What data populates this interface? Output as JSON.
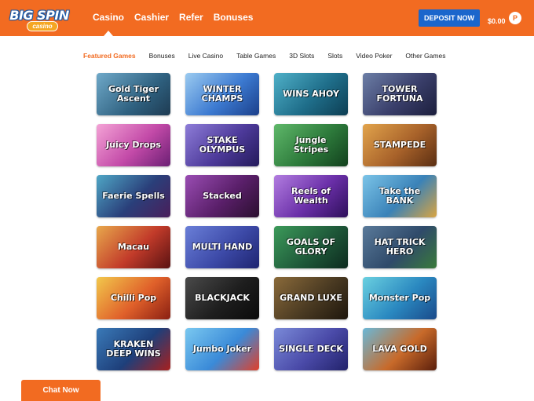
{
  "header": {
    "logo": {
      "main": "BIG SPIN",
      "sub": "casino"
    },
    "nav": [
      {
        "label": "Casino",
        "active": true
      },
      {
        "label": "Cashier"
      },
      {
        "label": "Refer"
      },
      {
        "label": "Bonuses"
      }
    ],
    "deposit_label": "DEPOSIT NOW",
    "balance": "$0.00",
    "profile_initial": "P"
  },
  "tabs": [
    {
      "label": "Featured Games",
      "active": true
    },
    {
      "label": "Bonuses"
    },
    {
      "label": "Live Casino"
    },
    {
      "label": "Table Games"
    },
    {
      "label": "3D Slots"
    },
    {
      "label": "Slots"
    },
    {
      "label": "Video Poker"
    },
    {
      "label": "Other Games"
    }
  ],
  "games": [
    {
      "title": "Gold Tiger Ascent",
      "bg": "linear-gradient(135deg,#6fa9c9,#2f6180 60%,#1e3b52)"
    },
    {
      "title": "WINTER CHAMPS",
      "bg": "linear-gradient(135deg,#9bcbf0,#3c7ad1 55%,#1b3f8a)"
    },
    {
      "title": "WINS AHOY",
      "bg": "linear-gradient(135deg,#4fb0c8,#1f6e8a 55%,#0d3d52)"
    },
    {
      "title": "TOWER FORTUNA",
      "bg": "linear-gradient(135deg,#6c7ea6,#3a3f6b 55%,#1c1e3c)"
    },
    {
      "title": "Juicy Drops",
      "bg": "linear-gradient(135deg,#f4a3d6,#c34aa8 55%,#6b1f74)"
    },
    {
      "title": "STAKE OLYMPUS",
      "bg": "linear-gradient(135deg,#8e7dd8,#4d3a9a 55%,#241a5a)"
    },
    {
      "title": "Jungle Stripes",
      "bg": "linear-gradient(135deg,#5fb86a,#2d7a3b 55%,#12401d)"
    },
    {
      "title": "STAMPEDE",
      "bg": "linear-gradient(135deg,#e2a44c,#a8622a 55%,#5a2e12)"
    },
    {
      "title": "Faerie Spells",
      "bg": "linear-gradient(135deg,#4fa7c6,#2a3f7a 55%,#4a1e5a)"
    },
    {
      "title": "Stacked",
      "bg": "linear-gradient(135deg,#9a4db3,#5a1f6a 55%,#2a0f2e)"
    },
    {
      "title": "Reels of Wealth",
      "bg": "linear-gradient(135deg,#b27de0,#6a2fa8 55%,#2e0f5a)"
    },
    {
      "title": "Take the BANK",
      "bg": "linear-gradient(135deg,#7bc4e8,#3a82b8 55%,#d9a441)"
    },
    {
      "title": "Macau",
      "bg": "linear-gradient(135deg,#e8a84c,#c23b2a 55%,#5a1212)"
    },
    {
      "title": "MULTI HAND",
      "bg": "linear-gradient(135deg,#6a7fd8,#3d4aa8 55%,#1e2470)"
    },
    {
      "title": "GOALS OF GLORY",
      "bg": "linear-gradient(135deg,#3c9a5a,#1f5a3a 55%,#0d2a1e)"
    },
    {
      "title": "HAT TRICK HERO",
      "bg": "linear-gradient(135deg,#5a7a9a,#2f4a6a 55%,#3a7a3a)"
    },
    {
      "title": "Chilli Pop",
      "bg": "linear-gradient(135deg,#f2c84c,#e0602a 55%,#8a1f12)"
    },
    {
      "title": "BLACKJACK",
      "bg": "linear-gradient(135deg,#4a4a4a,#1e1e1e 55%,#0a0a0a)"
    },
    {
      "title": "GRAND LUXE",
      "bg": "linear-gradient(135deg,#8a6a3a,#4a3a22 55%,#1e160c)"
    },
    {
      "title": "Monster Pop",
      "bg": "linear-gradient(135deg,#6ad0e0,#2a88c0 55%,#1a4a8a)"
    },
    {
      "title": "KRAKEN DEEP WINS",
      "bg": "linear-gradient(135deg,#3a7ab8,#1e3f7a 55%,#a8201e)"
    },
    {
      "title": "Jumbo Joker",
      "bg": "linear-gradient(135deg,#7ac8f0,#3a8ad8 55%,#e0402a)"
    },
    {
      "title": "SINGLE DECK",
      "bg": "linear-gradient(135deg,#7a8ad8,#4a4aa8 55%,#22226a)"
    },
    {
      "title": "LAVA GOLD",
      "bg": "linear-gradient(135deg,#6ab8d8,#c86a2a 55%,#5a1e0c)"
    }
  ],
  "chat_label": "Chat Now"
}
